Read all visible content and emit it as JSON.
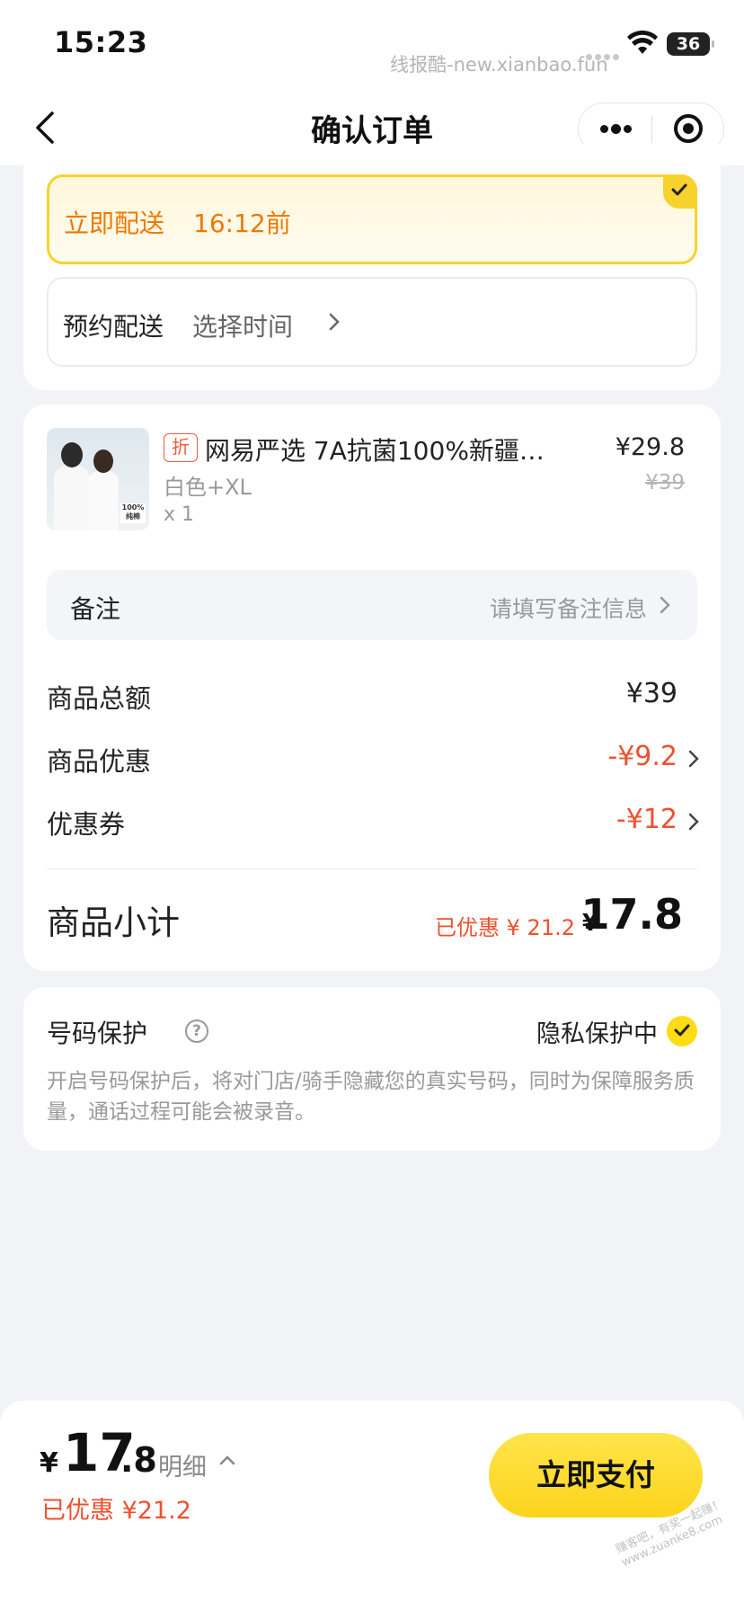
{
  "status_bar": {
    "time": "15:23",
    "watermark": "线报酷-new.xianbao.fun",
    "battery": "36"
  },
  "nav": {
    "title": "确认订单"
  },
  "delivery": {
    "immediate_label": "立即配送",
    "immediate_time": "16:12前",
    "scheduled_label": "预约配送",
    "scheduled_value": "选择时间"
  },
  "product": {
    "badge": "折",
    "title": "网易严选 7A抗菌100%新疆…",
    "variant": "白色+XL",
    "quantity": "x 1",
    "price": "¥29.8",
    "original_price": "¥39",
    "image_caption": "100% 纯棉"
  },
  "remark": {
    "label": "备注",
    "placeholder": "请填写备注信息"
  },
  "summary": {
    "total_label": "商品总额",
    "total_value": "¥39",
    "discount_label": "商品优惠",
    "discount_value": "-¥9.2",
    "coupon_label": "优惠券",
    "coupon_value": "-¥12",
    "subtotal_label": "商品小计",
    "subtotal_saved": "已优惠 ¥ 21.2",
    "subtotal_currency": "¥",
    "subtotal_value": "17.8"
  },
  "protection": {
    "title": "号码保护",
    "status": "隐私保护中",
    "description": "开启号码保护后，将对门店/骑手隐藏您的真实号码，同时为保障服务质量，通话过程可能会被录音。"
  },
  "bottom_bar": {
    "currency": "¥",
    "amount_int": "17",
    "amount_dec": ".8",
    "detail_label": "明细",
    "saved": "已优惠 ¥21.2",
    "pay_label": "立即支付",
    "watermark": "赚客吧，有奖一起赚！ www.zuanke8.com"
  },
  "colors": {
    "accent_yellow": "#fcd41c",
    "price_red": "#f0502e",
    "immediate_orange": "#f07800"
  }
}
